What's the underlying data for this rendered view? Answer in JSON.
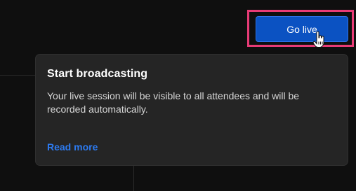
{
  "header": {
    "go_live_label": "Go live"
  },
  "cursor": {
    "icon": "hand-pointer-icon"
  },
  "tooltip": {
    "title": "Start broadcasting",
    "body": "Your live session will be visible to all attendees and will be recorded automatically.",
    "link_label": "Read more"
  },
  "colors": {
    "background": "#0f0f0f",
    "button": "#0b52c2",
    "highlight": "#e83b76",
    "card": "#252525",
    "link": "#2c7af0"
  }
}
